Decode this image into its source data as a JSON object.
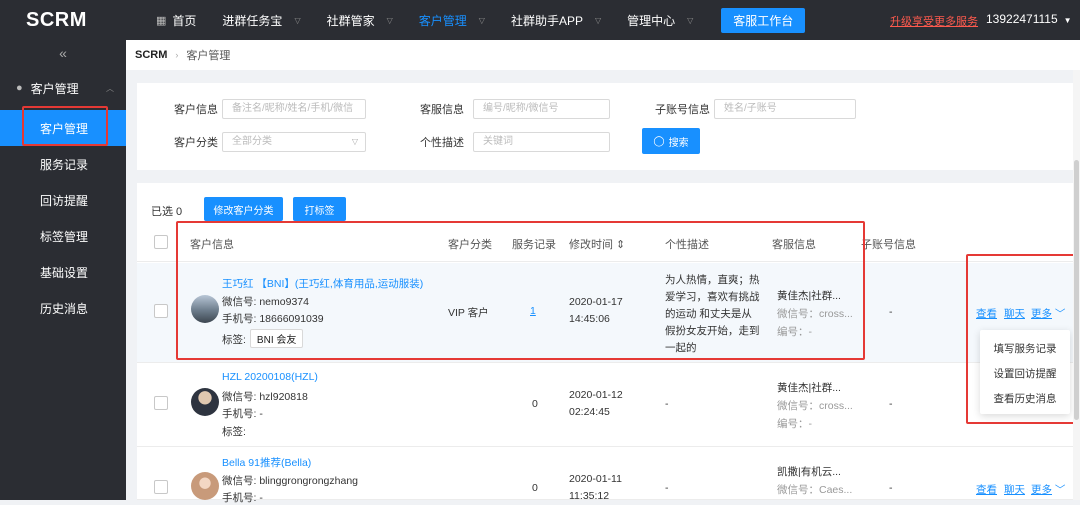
{
  "app": {
    "logo": "SCRM"
  },
  "topnav": {
    "items": [
      {
        "label": "首页",
        "has_caret": false
      },
      {
        "label": "进群任务宝",
        "has_caret": true
      },
      {
        "label": "社群管家",
        "has_caret": true
      },
      {
        "label": "客户管理",
        "has_caret": true,
        "active": true
      },
      {
        "label": "社群助手APP",
        "has_caret": true
      },
      {
        "label": "管理中心",
        "has_caret": true
      }
    ],
    "workbench_button": "客服工作台",
    "upgrade_link": "升级享受更多服务",
    "account": "13922471115"
  },
  "sidebar": {
    "collapse_icon": "«",
    "group_label": "客户管理",
    "items": [
      {
        "label": "客户管理",
        "active": true
      },
      {
        "label": "服务记录"
      },
      {
        "label": "回访提醒"
      },
      {
        "label": "标签管理"
      },
      {
        "label": "基础设置"
      },
      {
        "label": "历史消息"
      }
    ]
  },
  "breadcrumb": {
    "root": "SCRM",
    "current": "客户管理"
  },
  "filters": {
    "customer_info": {
      "label": "客户信息",
      "placeholder": "备注名/昵称/姓名/手机/微信"
    },
    "cs_info": {
      "label": "客服信息",
      "placeholder": "编号/昵称/微信号"
    },
    "sub_account": {
      "label": "子账号信息",
      "placeholder": "姓名/子账号"
    },
    "category": {
      "label": "客户分类",
      "placeholder": "全部分类"
    },
    "personal_desc": {
      "label": "个性描述",
      "placeholder": "关键词"
    },
    "search_button": "搜索"
  },
  "toolbar": {
    "selected_text": "已选 0",
    "modify_category_button": "修改客户分类",
    "tag_button": "打标签"
  },
  "table": {
    "headers": {
      "customer_info": "客户信息",
      "category": "客户分类",
      "service_record": "服务记录",
      "modified_time": "修改时间 ⇕",
      "personal_desc": "个性描述",
      "cs_info": "客服信息",
      "sub_account": "子账号信息"
    },
    "rows": [
      {
        "name": "王巧红 【BNI】(王巧红,体育用品,运动服装)",
        "wechat": "微信号: nemo9374",
        "phone": "手机号: 18666091039",
        "tag_label": "标签:",
        "tag": "BNI 会友",
        "category": "VIP 客户",
        "service_record": "1",
        "date": "2020-01-17",
        "time": "14:45:06",
        "desc": "为人热情，直爽；热爱学习，喜欢有挑战的运动 和丈夫是从假扮女友开始，走到一起的",
        "cs_name": "黄佳杰|社群...",
        "cs_wechat": "微信号：cross...",
        "cs_no": "编号：-",
        "sub_account": "-",
        "actions": {
          "view": "查看",
          "chat": "聊天",
          "more": "更多"
        }
      },
      {
        "name": "HZL 20200108(HZL)",
        "wechat": "微信号: hzl920818",
        "phone": "手机号: -",
        "tag_label": "标签:",
        "category": "",
        "service_record": "0",
        "date": "2020-01-12",
        "time": "02:24:45",
        "desc": "-",
        "cs_name": "黄佳杰|社群...",
        "cs_wechat": "微信号：cross...",
        "cs_no": "编号：-",
        "sub_account": "-"
      },
      {
        "name": "Bella 91推荐(Bella)",
        "wechat": "微信号: blinggrongrongzhang",
        "phone": "手机号: -",
        "category": "",
        "service_record": "0",
        "date": "2020-01-11",
        "time": "11:35:12",
        "desc": "-",
        "cs_name": "凯撒|有机云...",
        "cs_wechat": "微信号：Caes...",
        "sub_account": "-",
        "actions": {
          "view": "查看",
          "chat": "聊天",
          "more": "更多"
        }
      }
    ]
  },
  "more_dropdown": {
    "items": [
      "填写服务记录",
      "设置回访提醒",
      "查看历史消息"
    ]
  },
  "colors": {
    "primary": "#1890ff",
    "dark_bg": "#2b2d33",
    "highlight_red": "#e53935",
    "upgrade_red": "#ff5a4e"
  }
}
